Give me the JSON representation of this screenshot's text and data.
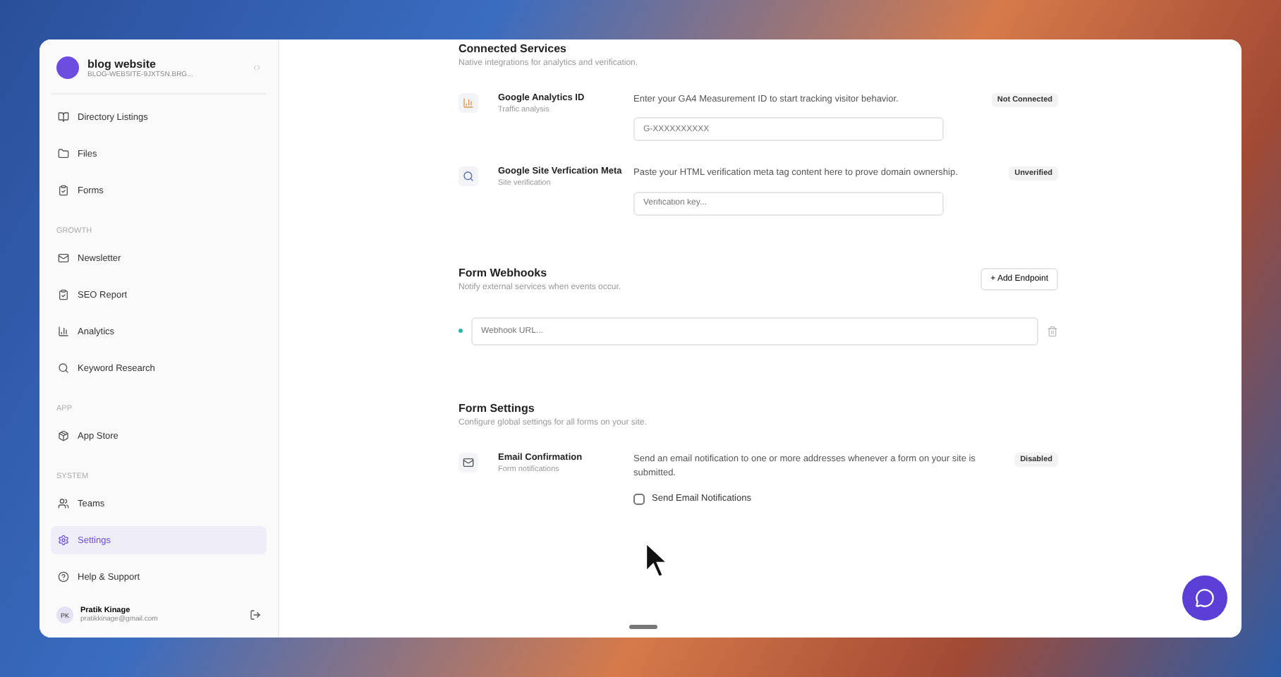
{
  "workspace": {
    "name": "blog website",
    "slug": "BLOG-WEBSITE-9JXTSN.BRG..."
  },
  "sidebar": {
    "groups": [
      {
        "items": [
          {
            "label": "Directory Listings",
            "kind": "book",
            "selected": false
          },
          {
            "label": "Files",
            "kind": "folder",
            "selected": false
          },
          {
            "label": "Forms",
            "kind": "clipboard",
            "selected": false
          }
        ]
      },
      {
        "title": "GROWTH",
        "items": [
          {
            "label": "Newsletter",
            "kind": "mail",
            "selected": false
          },
          {
            "label": "SEO Report",
            "kind": "clipboard",
            "selected": false
          },
          {
            "label": "Analytics",
            "kind": "chart",
            "selected": false
          },
          {
            "label": "Keyword Research",
            "kind": "search",
            "selected": false
          }
        ]
      },
      {
        "title": "APP",
        "items": [
          {
            "label": "App Store",
            "kind": "package",
            "selected": false
          }
        ]
      },
      {
        "title": "SYSTEM",
        "items": [
          {
            "label": "Teams",
            "kind": "users",
            "selected": false
          },
          {
            "label": "Settings",
            "kind": "gear",
            "selected": true
          },
          {
            "label": "Help & Support",
            "kind": "help",
            "selected": false
          }
        ]
      }
    ]
  },
  "user": {
    "initials": "PK",
    "name": "Pratik Kinage",
    "email": "pratikkinage@gmail.com"
  },
  "connected_services": {
    "title": "Connected Services",
    "subtitle": "Native integrations for analytics and verification.",
    "services": [
      {
        "kind": "chart",
        "name": "Google Analytics ID",
        "category": "Traffic analysis",
        "description": "Enter your GA4 Measurement ID to start tracking visitor behavior.",
        "placeholder": "G-XXXXXXXXXX",
        "status": "Not Connected"
      },
      {
        "kind": "search",
        "name": "Google Site Verfication Meta",
        "category": "Site verification",
        "description": "Paste your HTML verification meta tag content here to prove domain ownership.",
        "placeholder": "Verification key...",
        "status": "Unverified"
      }
    ]
  },
  "webhooks": {
    "title": "Form Webhooks",
    "subtitle": "Notify external services when events occur.",
    "add_button": "+ Add Endpoint",
    "placeholder": "Webhook URL..."
  },
  "form_settings": {
    "title": "Form Settings",
    "subtitle": "Configure global settings for all forms on your site.",
    "setting": {
      "name": "Email Confirmation",
      "category": "Form notifications",
      "description": "Send an email notification to one or more addresses whenever a form on your site is submitted.",
      "status": "Disabled",
      "checkbox_label": "Send Email Notifications",
      "checked": false
    }
  }
}
